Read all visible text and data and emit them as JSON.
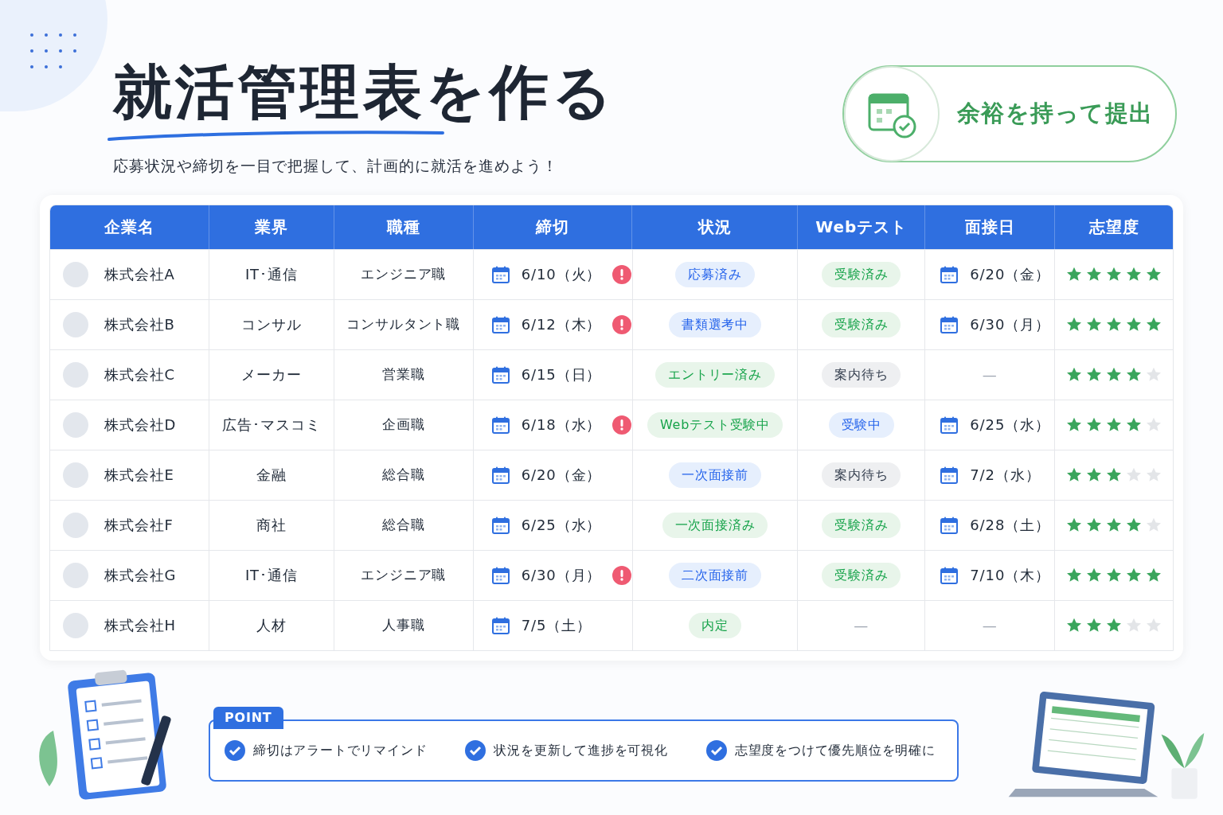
{
  "title": "就活管理表を作る",
  "subtitle": "応募状況や締切を一目で把握して、計画的に就活を進めよう！",
  "badge": {
    "label": "余裕を持って提出"
  },
  "table": {
    "columns": [
      "企業名",
      "業界",
      "職種",
      "締切",
      "状況",
      "Webテスト",
      "面接日",
      "志望度"
    ],
    "rows": [
      {
        "company": "株式会社A",
        "industry": "IT･通信",
        "job": "エンジニア職",
        "deadline": {
          "text": "6/10（火）",
          "alert": true
        },
        "status": {
          "label": "応募済み",
          "color": "#2563eb"
        },
        "webtest": {
          "kind": "badge",
          "label": "受験済み",
          "color": "#16a34a"
        },
        "interview": {
          "kind": "date",
          "text": "6/20（金）"
        },
        "stars": 5
      },
      {
        "company": "株式会社B",
        "industry": "コンサル",
        "job": "コンサルタント職",
        "deadline": {
          "text": "6/12（木）",
          "alert": true
        },
        "status": {
          "label": "書類選考中",
          "color": "#2563eb"
        },
        "webtest": {
          "kind": "badge",
          "label": "受験済み",
          "color": "#16a34a"
        },
        "interview": {
          "kind": "date",
          "text": "6/30（月）"
        },
        "stars": 5
      },
      {
        "company": "株式会社C",
        "industry": "メーカー",
        "job": "営業職",
        "deadline": {
          "text": "6/15（日）",
          "alert": false
        },
        "status": {
          "label": "エントリー済み",
          "color": "#16a34a"
        },
        "webtest": {
          "kind": "badge",
          "label": "案内待ち",
          "color": "#374151"
        },
        "interview": {
          "kind": "none",
          "text": "—"
        },
        "stars": 4
      },
      {
        "company": "株式会社D",
        "industry": "広告･マスコミ",
        "job": "企画職",
        "deadline": {
          "text": "6/18（水）",
          "alert": true
        },
        "status": {
          "label": "Webテスト受験中",
          "color": "#16a34a"
        },
        "webtest": {
          "kind": "badge",
          "label": "受験中",
          "color": "#2563eb"
        },
        "interview": {
          "kind": "date",
          "text": "6/25（水）"
        },
        "stars": 4
      },
      {
        "company": "株式会社E",
        "industry": "金融",
        "job": "総合職",
        "deadline": {
          "text": "6/20（金）",
          "alert": false
        },
        "status": {
          "label": "一次面接前",
          "color": "#2563eb"
        },
        "webtest": {
          "kind": "badge",
          "label": "案内待ち",
          "color": "#374151"
        },
        "interview": {
          "kind": "date",
          "text": "7/2（水）"
        },
        "stars": 3
      },
      {
        "company": "株式会社F",
        "industry": "商社",
        "job": "総合職",
        "deadline": {
          "text": "6/25（水）",
          "alert": false
        },
        "status": {
          "label": "一次面接済み",
          "color": "#16a34a"
        },
        "webtest": {
          "kind": "badge",
          "label": "受験済み",
          "color": "#16a34a"
        },
        "interview": {
          "kind": "date",
          "text": "6/28（土）"
        },
        "stars": 4
      },
      {
        "company": "株式会社G",
        "industry": "IT･通信",
        "job": "エンジニア職",
        "deadline": {
          "text": "6/30（月）",
          "alert": true
        },
        "status": {
          "label": "二次面接前",
          "color": "#2563eb"
        },
        "webtest": {
          "kind": "badge",
          "label": "受験済み",
          "color": "#16a34a"
        },
        "interview": {
          "kind": "date",
          "text": "7/10（木）"
        },
        "stars": 5
      },
      {
        "company": "株式会社H",
        "industry": "人材",
        "job": "人事職",
        "deadline": {
          "text": "7/5（土）",
          "alert": false
        },
        "status": {
          "label": "内定",
          "color": "#16a34a"
        },
        "webtest": {
          "kind": "none",
          "label": "—"
        },
        "interview": {
          "kind": "none",
          "text": "—"
        },
        "stars": 3
      }
    ]
  },
  "point": {
    "label": "POINT",
    "items": [
      "締切はアラートでリマインド",
      "状況を更新して進捗を可視化",
      "志望度をつけて優先順位を明確に"
    ]
  }
}
